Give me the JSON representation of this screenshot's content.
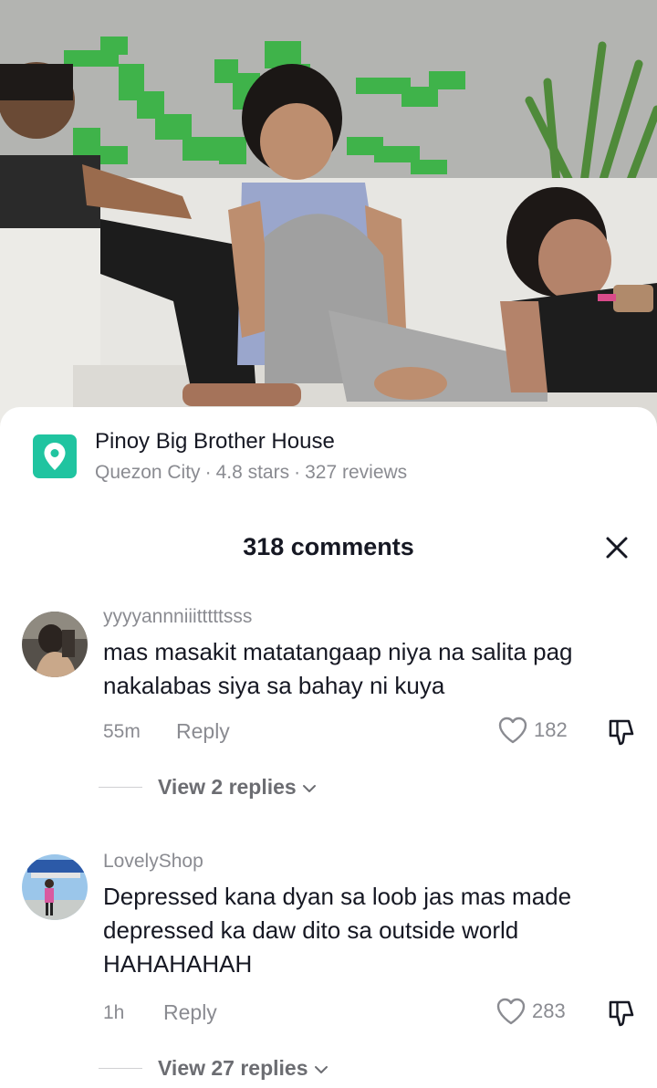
{
  "place": {
    "icon": "location-pin-icon",
    "accent": "#20c4a0",
    "name": "Pinoy Big Brother House",
    "city": "Quezon City",
    "rating": "4.8 stars",
    "reviews": "327 reviews",
    "separator": "·"
  },
  "comments_panel": {
    "title": "318 comments",
    "close_icon": "close-icon"
  },
  "comments": [
    {
      "username": "yyyyannniiitttttsss",
      "text": "mas masakit matatangaap niya na salita pag nakalabas siya sa bahay ni kuya",
      "time": "55m",
      "reply_label": "Reply",
      "likes": "182",
      "view_replies": "View 2 replies"
    },
    {
      "username": "LovelyShop",
      "text": "Depressed kana dyan sa loob jas mas made depressed ka daw dito sa outside world HAHAHAHAH",
      "time": "1h",
      "reply_label": "Reply",
      "likes": "283",
      "view_replies": "View 27 replies"
    }
  ],
  "colors": {
    "text_primary": "#161823",
    "text_secondary": "#8a8b91"
  }
}
